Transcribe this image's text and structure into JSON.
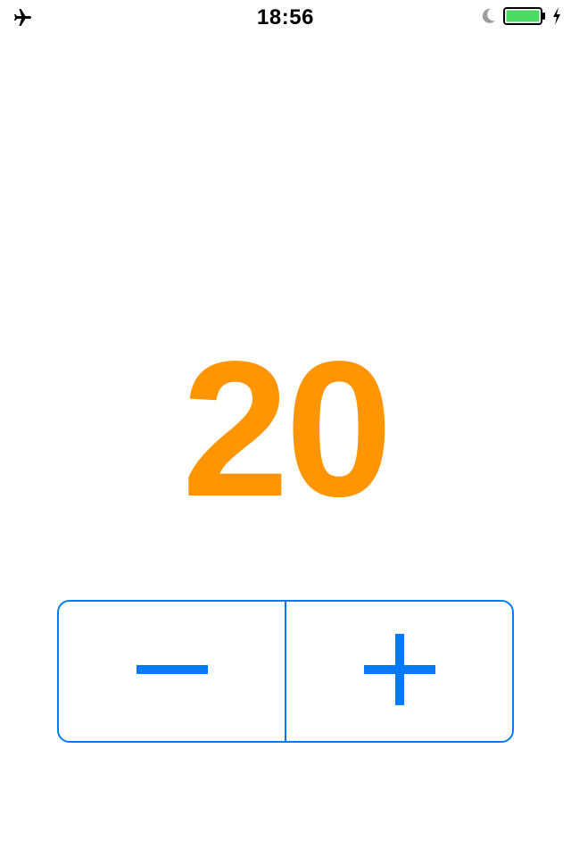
{
  "status_bar": {
    "time": "18:56",
    "icons": {
      "left": "airplane-icon",
      "right": [
        "moon-icon",
        "battery-icon",
        "charging-bolt-icon"
      ]
    },
    "battery_color": "#4CD964"
  },
  "counter": {
    "value": "20",
    "color": "#FF9500"
  },
  "stepper": {
    "accent_color": "#007AFF",
    "decrement_icon": "minus-icon",
    "increment_icon": "plus-icon"
  }
}
